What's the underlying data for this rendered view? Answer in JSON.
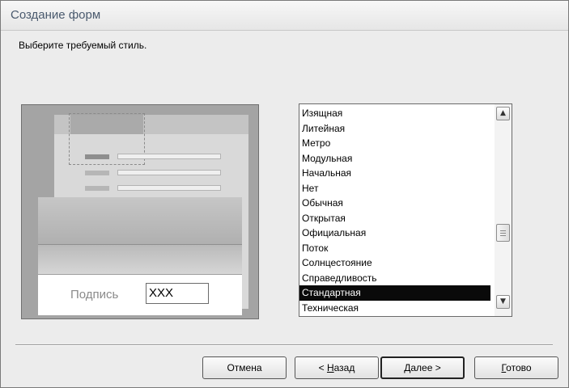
{
  "window": {
    "title": "Создание форм"
  },
  "prompt": "Выберите требуемый стиль.",
  "preview": {
    "caption": "Подпись",
    "field_value": "XXX"
  },
  "styles": {
    "items": [
      "Изящная",
      "Литейная",
      "Метро",
      "Модульная",
      "Начальная",
      "Нет",
      "Обычная",
      "Открытая",
      "Официальная",
      "Поток",
      "Солнцестояние",
      "Справедливость",
      "Стандартная",
      "Техническая"
    ],
    "selected": "Стандартная"
  },
  "buttons": {
    "cancel": "Отмена",
    "back_prefix": "< ",
    "back_ul": "Н",
    "back_rest": "азад",
    "next_ul": "Д",
    "next_rest": "алее >",
    "finish_ul": "Г",
    "finish_rest": "отово"
  },
  "colors": {
    "selection": "#0a0a0a",
    "title_text": "#4a5a6e"
  },
  "icons": {
    "scroll_up": "arrow-up-icon",
    "scroll_down": "arrow-down-icon"
  }
}
